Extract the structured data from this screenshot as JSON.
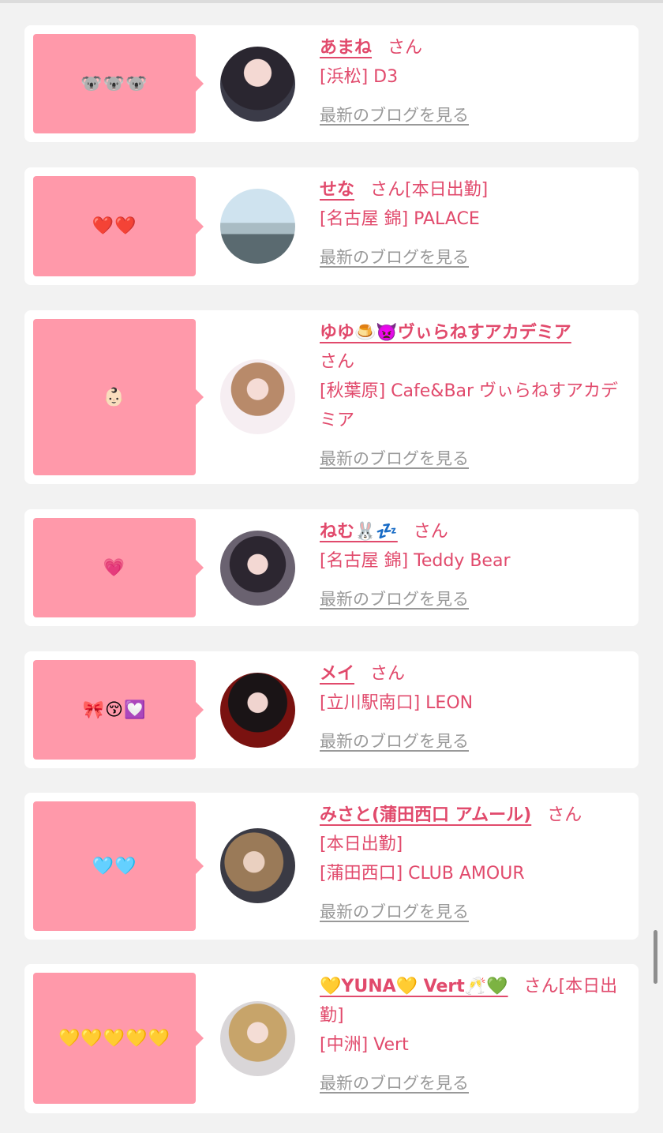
{
  "blog_link_label": "最新のブログを見る",
  "san_label": "さん",
  "entries": [
    {
      "comment": "🐨🐨🐨",
      "name": "あまね",
      "status": "",
      "shop": "[浜松] D3"
    },
    {
      "comment": "❤️❤️",
      "name": "せな",
      "status": "[本日出勤]",
      "shop": "[名古屋 錦] PALACE"
    },
    {
      "comment": "👶🏻",
      "name": "ゆゆ🍮👿ヴぃらねすアカデミア",
      "status": "",
      "shop": "[秋葉原] Cafe&Bar ヴぃらねすアカデミア"
    },
    {
      "comment": "💗",
      "name": "ねむ🐰💤",
      "status": "",
      "shop": "[名古屋 錦] Teddy Bear"
    },
    {
      "comment": "🎀😚💟",
      "name": "メイ",
      "status": "",
      "shop": "[立川駅南口] LEON"
    },
    {
      "comment": "🩵🩵",
      "name": "みさと(蒲田西口 アムール)",
      "status": "[本日出勤]",
      "shop": "[蒲田西口] CLUB AMOUR"
    },
    {
      "comment": "💛💛💛💛💛",
      "name": "💛YUNA💛 Vert🥂💚",
      "status": "[本日出勤]",
      "shop": "[中洲] Vert"
    }
  ],
  "colors": {
    "accent": "#e14a6c",
    "bubble": "#ff99aa",
    "muted": "#999999",
    "background": "#f2f2f2"
  }
}
